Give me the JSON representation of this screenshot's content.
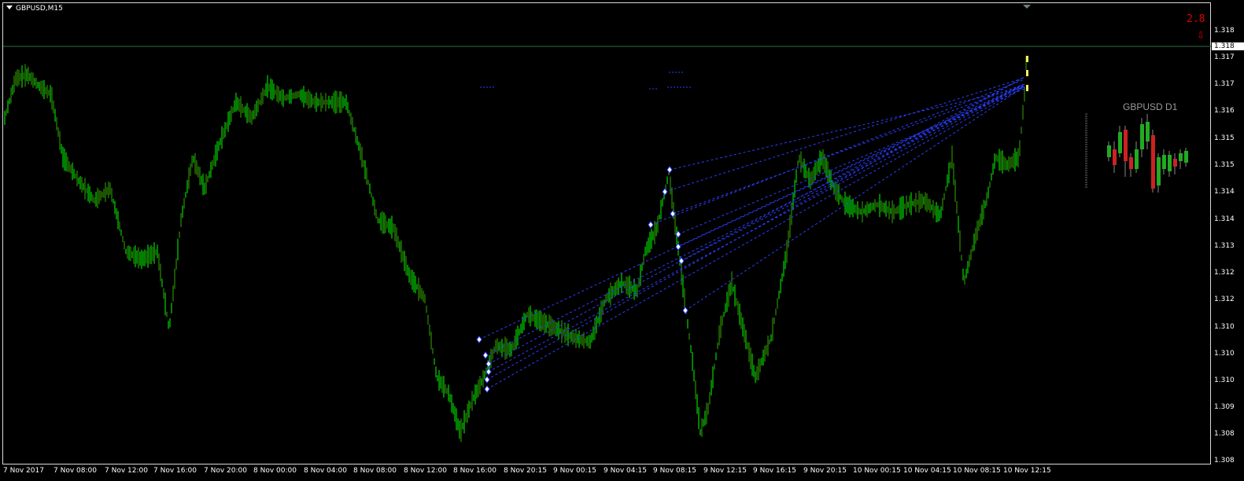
{
  "window": {
    "symbol_title": "GBPUSD,M15"
  },
  "colors": {
    "background": "#000000",
    "candles": "#00ff00",
    "candles_dark": "#33aa00",
    "trend_lines": "#2a3fff",
    "current_price_line": "#2e6b43",
    "spread_text": "#e00000",
    "mini_bull": "#22aa22",
    "mini_bear": "#cc2222"
  },
  "spread": {
    "value": "2.8",
    "arrow_icon": "down-arrow-icon"
  },
  "price_axis": {
    "labels": [
      "1.318",
      "1.317",
      "1.317",
      "1.316",
      "1.315",
      "1.315",
      "1.314",
      "1.314",
      "1.313",
      "1.312",
      "1.312",
      "1.310",
      "1.310",
      "1.310",
      "1.309",
      "1.308",
      "1.308"
    ],
    "current_price": "1.318"
  },
  "time_axis": {
    "labels": [
      "7 Nov 2017",
      "7 Nov 08:00",
      "7 Nov 12:00",
      "7 Nov 16:00",
      "7 Nov 20:00",
      "8 Nov 00:00",
      "8 Nov 04:00",
      "8 Nov 08:00",
      "8 Nov 12:00",
      "8 Nov 16:00",
      "8 Nov 20:15",
      "9 Nov 00:15",
      "9 Nov 04:15",
      "9 Nov 08:15",
      "9 Nov 12:15",
      "9 Nov 16:15",
      "9 Nov 20:15",
      "10 Nov 00:15",
      "10 Nov 04:15",
      "10 Nov 08:15",
      "10 Nov 12:15"
    ]
  },
  "mini_chart": {
    "title": "GBPUSD D1"
  }
}
